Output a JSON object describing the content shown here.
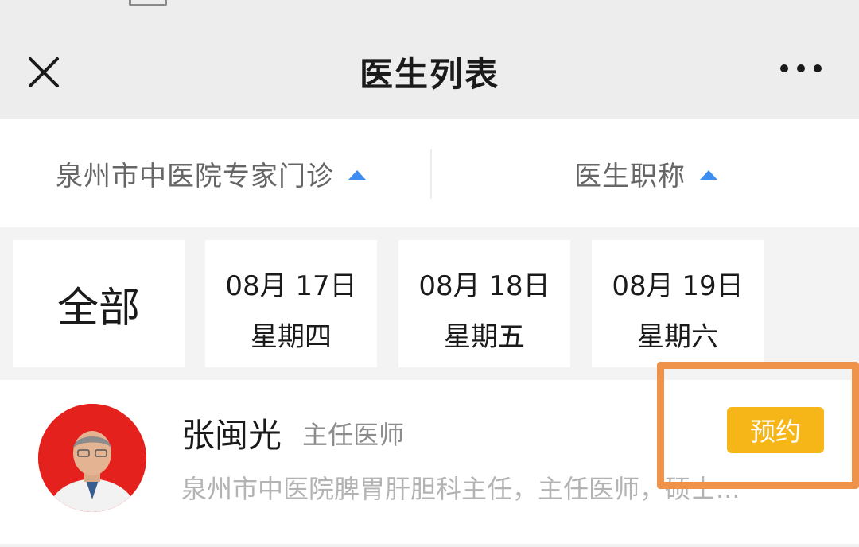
{
  "header": {
    "title": "医生列表"
  },
  "filters": [
    {
      "label": "泉州市中医院专家门诊"
    },
    {
      "label": "医生职称"
    }
  ],
  "dates": {
    "all_label": "全部",
    "days": [
      {
        "date": "08月 17日",
        "weekday": "星期四"
      },
      {
        "date": "08月 18日",
        "weekday": "星期五"
      },
      {
        "date": "08月 19日",
        "weekday": "星期六"
      }
    ]
  },
  "doctor": {
    "name": "张闽光",
    "title": "主任医师",
    "description": "泉州市中医院脾胃肝胆科主任，主任医师，硕士...",
    "book_label": "预约"
  },
  "colors": {
    "accent_blue": "#3d8ef0",
    "book_button": "#f7b618",
    "highlight": "#f0934a",
    "avatar_bg": "#e4211d"
  },
  "icons": [
    "close-icon",
    "more-icon",
    "caret-up-icon"
  ]
}
